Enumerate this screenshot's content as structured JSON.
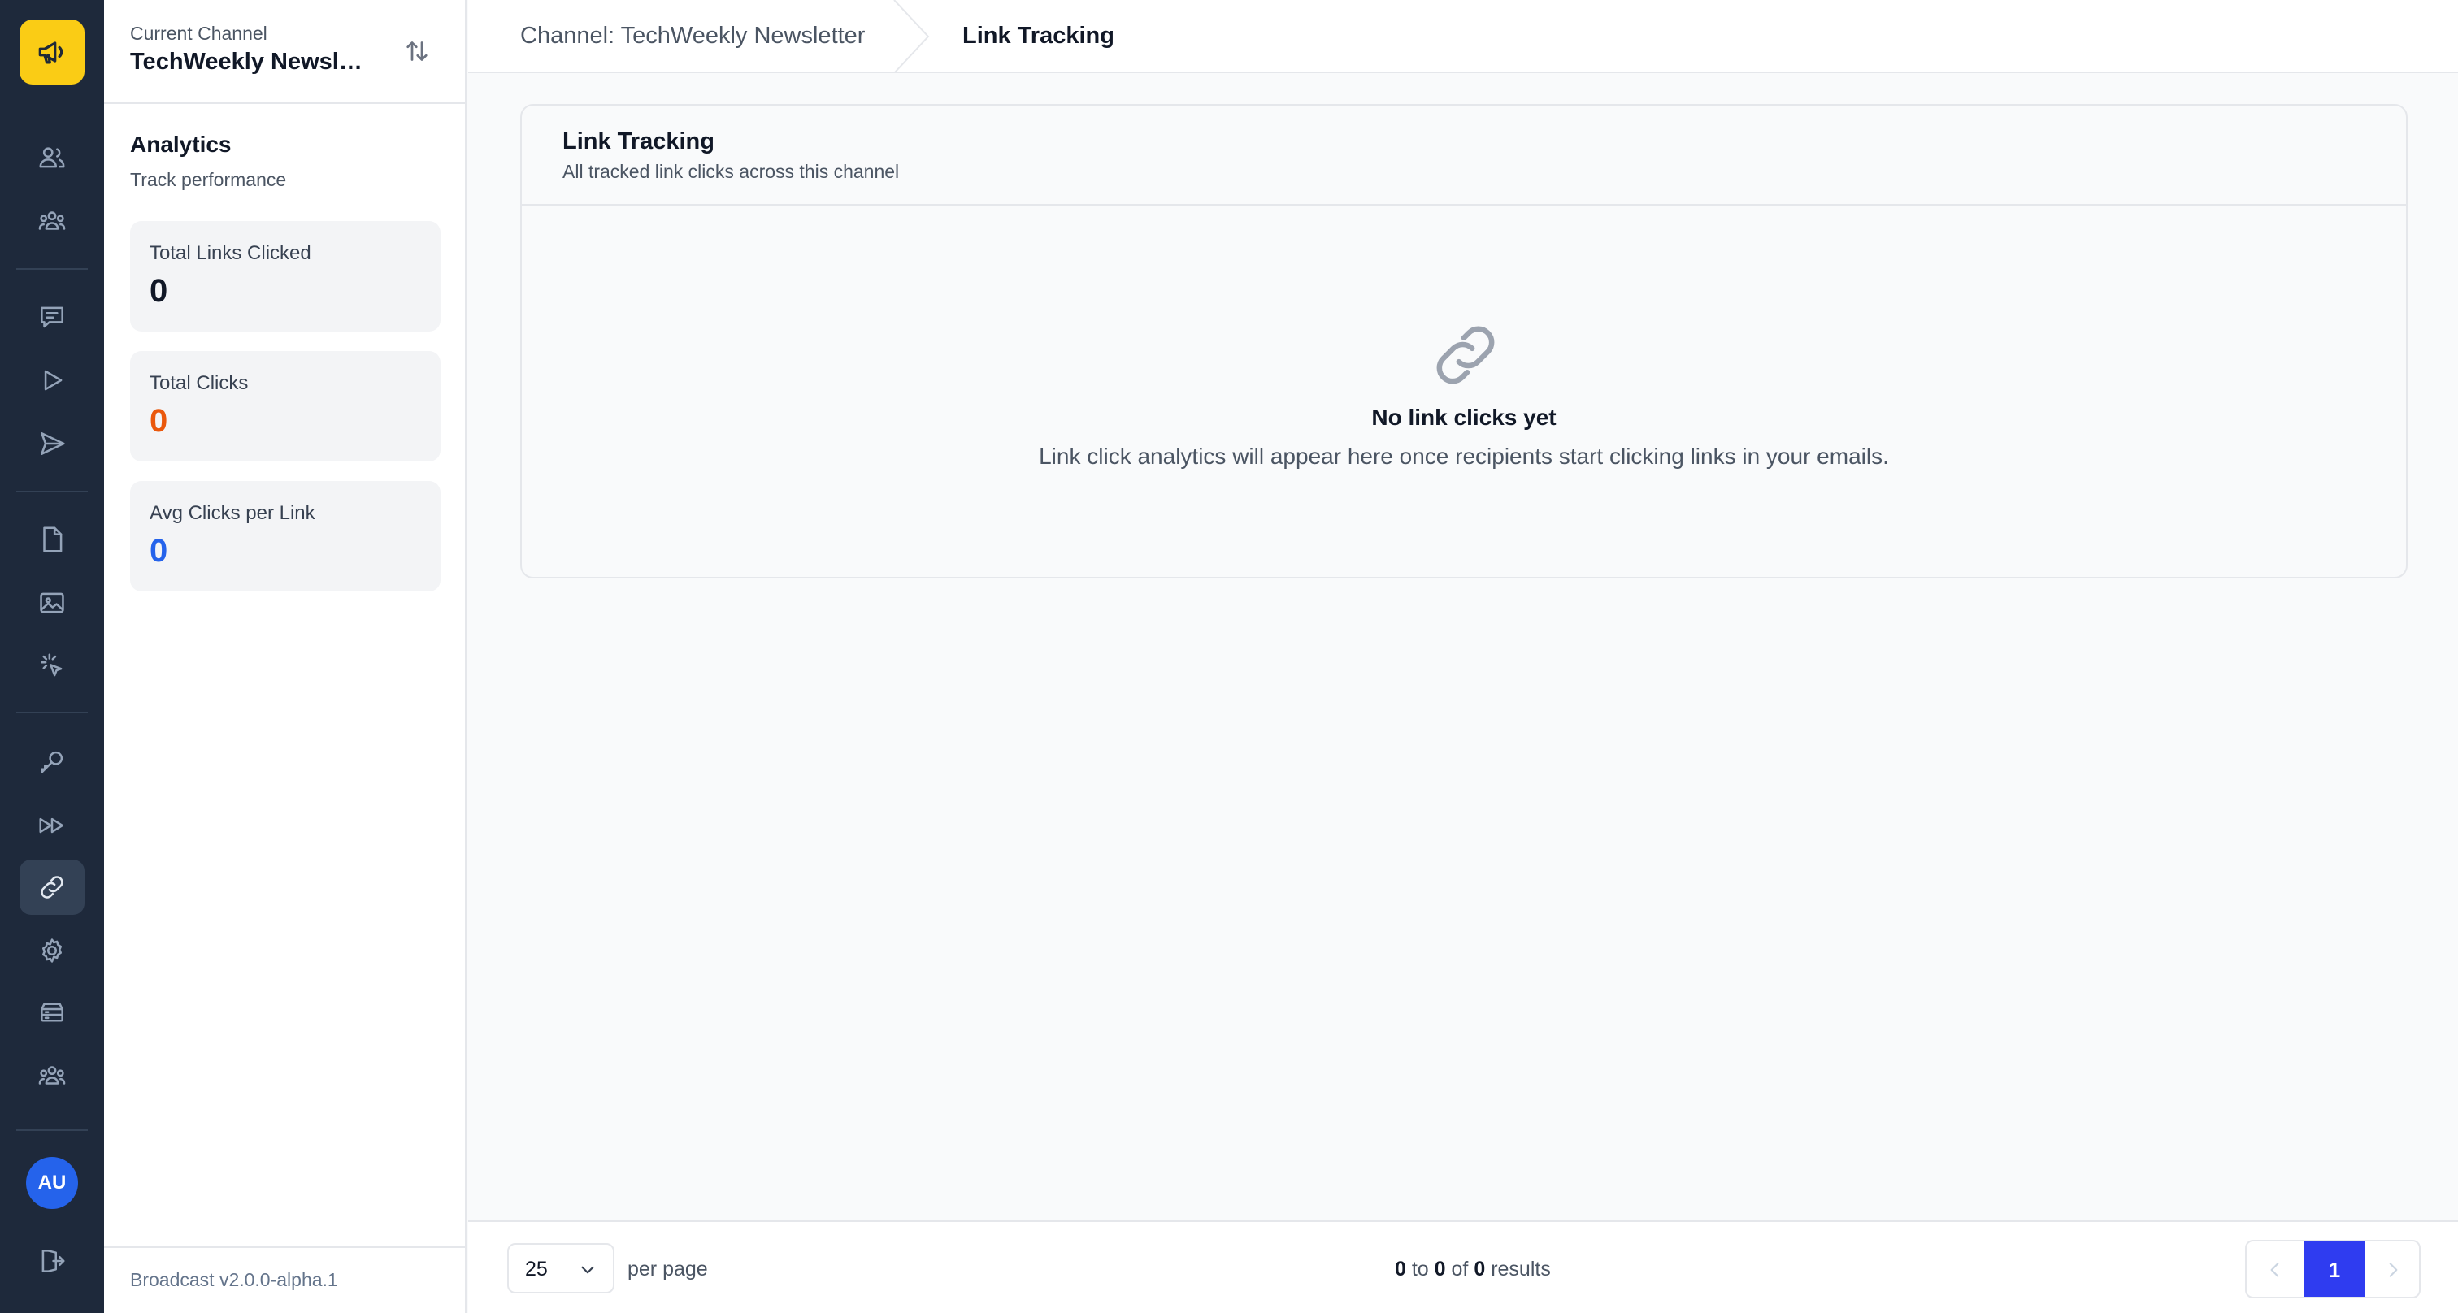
{
  "rail": {
    "items": [
      {
        "icon": "megaphone-icon"
      },
      {
        "icon": "users-icon"
      },
      {
        "icon": "user-group-icon"
      },
      {
        "icon": "chat-icon"
      },
      {
        "icon": "play-icon"
      },
      {
        "icon": "send-icon"
      },
      {
        "icon": "document-icon"
      },
      {
        "icon": "image-icon"
      },
      {
        "icon": "cursor-click-icon"
      },
      {
        "icon": "key-icon"
      },
      {
        "icon": "fast-forward-icon"
      },
      {
        "icon": "link-icon",
        "active": true
      },
      {
        "icon": "gear-icon"
      },
      {
        "icon": "server-icon"
      },
      {
        "icon": "team-icon"
      },
      {
        "icon": "logout-icon"
      }
    ],
    "avatar_initials": "AU"
  },
  "sidebar": {
    "current_channel_label": "Current Channel",
    "current_channel_name": "TechWeekly Newsletter",
    "section_title": "Analytics",
    "section_subtitle": "Track performance",
    "stats": [
      {
        "label": "Total Links Clicked",
        "value": "0",
        "color": "#111827"
      },
      {
        "label": "Total Clicks",
        "value": "0",
        "color": "#ea580c"
      },
      {
        "label": "Avg Clicks per Link",
        "value": "0",
        "color": "#2563eb"
      }
    ],
    "version": "Broadcast v2.0.0-alpha.1"
  },
  "breadcrumb": {
    "parent": "Channel: TechWeekly Newsletter",
    "current": "Link Tracking"
  },
  "card": {
    "title": "Link Tracking",
    "subtitle": "All tracked link clicks across this channel",
    "empty_title": "No link clicks yet",
    "empty_text": "Link click analytics will appear here once recipients start clicking links in your emails."
  },
  "footer": {
    "per_page_value": "25",
    "per_page_label": "per page",
    "results": {
      "from": "0",
      "to_word": "to",
      "to": "0",
      "of_word": "of",
      "total": "0",
      "results_word": "results"
    },
    "current_page": "1"
  },
  "colors": {
    "rail_bg": "#1e293b",
    "logo_bg": "#facc15",
    "accent": "#2f3cf0",
    "avatar_bg": "#2563eb"
  }
}
